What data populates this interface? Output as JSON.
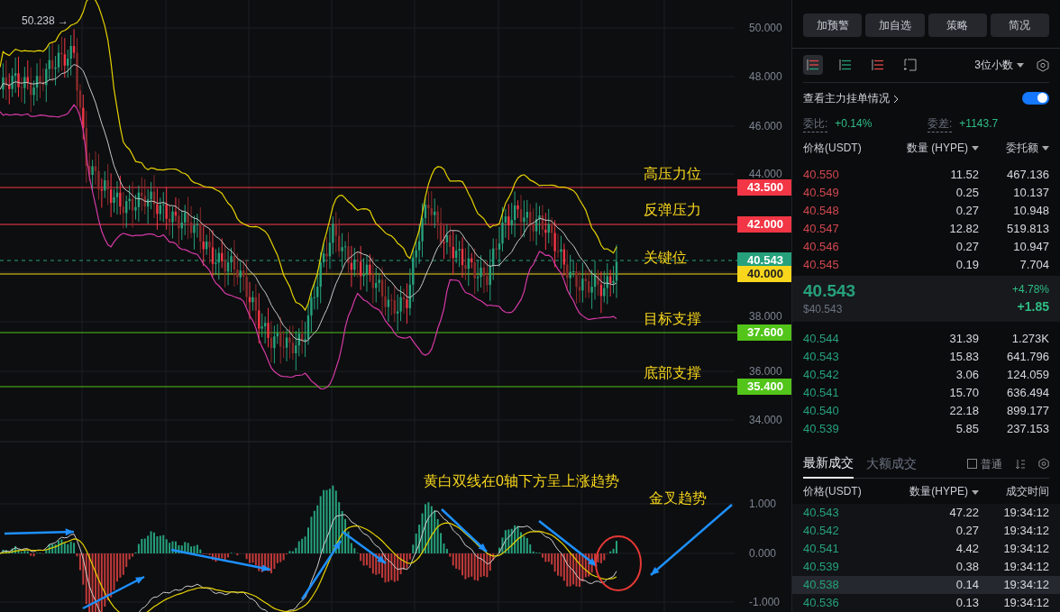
{
  "chart": {
    "peak_label": "50.238 →",
    "price_axis": [
      "50.000",
      "48.000",
      "46.000",
      "44.000",
      "38.000",
      "36.000",
      "34.000"
    ],
    "price_tags": [
      {
        "price": "43.500",
        "color": "#f23645",
        "kind": "solid"
      },
      {
        "price": "42.000",
        "color": "#f23645",
        "kind": "solid"
      },
      {
        "price": "40.543",
        "color": "#26a17b",
        "kind": "dashed"
      },
      {
        "price": "40.000",
        "color": "#f7d61c",
        "kind": "solid"
      },
      {
        "price": "37.600",
        "color": "#52c41a",
        "kind": "solid"
      },
      {
        "price": "35.400",
        "color": "#52c41a",
        "kind": "solid"
      }
    ],
    "annotations": [
      "高压力位",
      "反弹压力",
      "关键位",
      "目标支撑",
      "底部支撑"
    ],
    "macd_note": "黄白双线在0轴下方呈上涨趋势",
    "macd_signal": "金叉趋势",
    "macd_axis": [
      "1.000",
      "0.000",
      "-1.000"
    ]
  },
  "panel": {
    "buttons": [
      "加预警",
      "加自选",
      "策略",
      "简况"
    ],
    "views": [
      {
        "kind": "both",
        "selected": true
      },
      {
        "kind": "bids",
        "selected": false
      },
      {
        "kind": "asks",
        "selected": false
      },
      {
        "kind": "custom",
        "selected": false
      }
    ],
    "decimals": "3位小数",
    "main_orders": {
      "label": "查看主力挂单情况",
      "on": true
    },
    "ratio": {
      "label": "委比:",
      "value": "+0.14%"
    },
    "diff": {
      "label": "委差:",
      "value": "+1143.7"
    },
    "book_columns": [
      "价格(USDT)",
      "数量 (HYPE)",
      "委托额"
    ],
    "asks": [
      [
        "40.550",
        "11.52",
        "467.136"
      ],
      [
        "40.549",
        "0.25",
        "10.137"
      ],
      [
        "40.548",
        "0.27",
        "10.948"
      ],
      [
        "40.547",
        "12.82",
        "519.813"
      ],
      [
        "40.546",
        "0.27",
        "10.947"
      ],
      [
        "40.545",
        "0.19",
        "7.704"
      ]
    ],
    "last": {
      "price": "40.543",
      "usd": "$40.543",
      "change_pct": "+4.78%",
      "change": "+1.85"
    },
    "bids": [
      [
        "40.544",
        "31.39",
        "1.273K"
      ],
      [
        "40.543",
        "15.83",
        "641.796"
      ],
      [
        "40.542",
        "3.06",
        "124.059"
      ],
      [
        "40.541",
        "15.70",
        "636.494"
      ],
      [
        "40.540",
        "22.18",
        "899.177"
      ],
      [
        "40.539",
        "5.85",
        "237.153"
      ]
    ],
    "trade_tabs": [
      {
        "label": "最新成交",
        "selected": true
      },
      {
        "label": "大额成交",
        "selected": false
      }
    ],
    "normal": {
      "label": "普通",
      "checked": false
    },
    "trade_columns": [
      "价格(USDT)",
      "数量(HYPE)",
      "成交时间"
    ],
    "trades": [
      {
        "cells": [
          "40.543",
          "47.22",
          "19:34:12"
        ],
        "selected": false
      },
      {
        "cells": [
          "40.542",
          "0.27",
          "19:34:12"
        ],
        "selected": false
      },
      {
        "cells": [
          "40.541",
          "4.42",
          "19:34:12"
        ],
        "selected": false
      },
      {
        "cells": [
          "40.539",
          "0.38",
          "19:34:12"
        ],
        "selected": false
      },
      {
        "cells": [
          "40.538",
          "0.14",
          "19:34:12"
        ],
        "selected": true
      },
      {
        "cells": [
          "40.536",
          "0.13",
          "19:34:12"
        ],
        "selected": false
      }
    ]
  }
}
